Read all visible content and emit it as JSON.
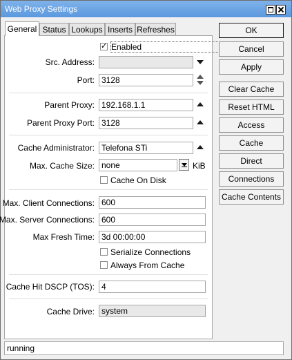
{
  "window": {
    "title": "Web Proxy Settings"
  },
  "tabs": [
    {
      "label": "General",
      "active": true
    },
    {
      "label": "Status"
    },
    {
      "label": "Lookups"
    },
    {
      "label": "Inserts"
    },
    {
      "label": "Refreshes"
    }
  ],
  "general": {
    "enabled": {
      "label": "Enabled",
      "checked": true
    },
    "src_address": {
      "label": "Src. Address:",
      "value": ""
    },
    "port": {
      "label": "Port:",
      "value": "3128"
    },
    "parent_proxy": {
      "label": "Parent Proxy:",
      "value": "192.168.1.1"
    },
    "parent_proxy_port": {
      "label": "Parent Proxy Port:",
      "value": "3128"
    },
    "cache_administrator": {
      "label": "Cache Administrator:",
      "value": "Telefona STi"
    },
    "max_cache_size": {
      "label": "Max. Cache Size:",
      "value": "none",
      "unit": "KiB"
    },
    "cache_on_disk": {
      "label": "Cache On Disk",
      "checked": false
    },
    "max_client_connections": {
      "label": "Max. Client Connections:",
      "value": "600"
    },
    "max_server_connections": {
      "label": "Max. Server Connections:",
      "value": "600"
    },
    "max_fresh_time": {
      "label": "Max Fresh Time:",
      "value": "3d 00:00:00"
    },
    "serialize_connections": {
      "label": "Serialize Connections",
      "checked": false
    },
    "always_from_cache": {
      "label": "Always From Cache",
      "checked": false
    },
    "cache_hit_dscp": {
      "label": "Cache Hit DSCP (TOS):",
      "value": "4"
    },
    "cache_drive": {
      "label": "Cache Drive:",
      "value": "system"
    }
  },
  "buttons": {
    "ok": "OK",
    "cancel": "Cancel",
    "apply": "Apply",
    "clear_cache": "Clear Cache",
    "reset_html": "Reset HTML",
    "access": "Access",
    "cache": "Cache",
    "direct": "Direct",
    "connections": "Connections",
    "cache_contents": "Cache Contents"
  },
  "status": {
    "text": "running"
  }
}
